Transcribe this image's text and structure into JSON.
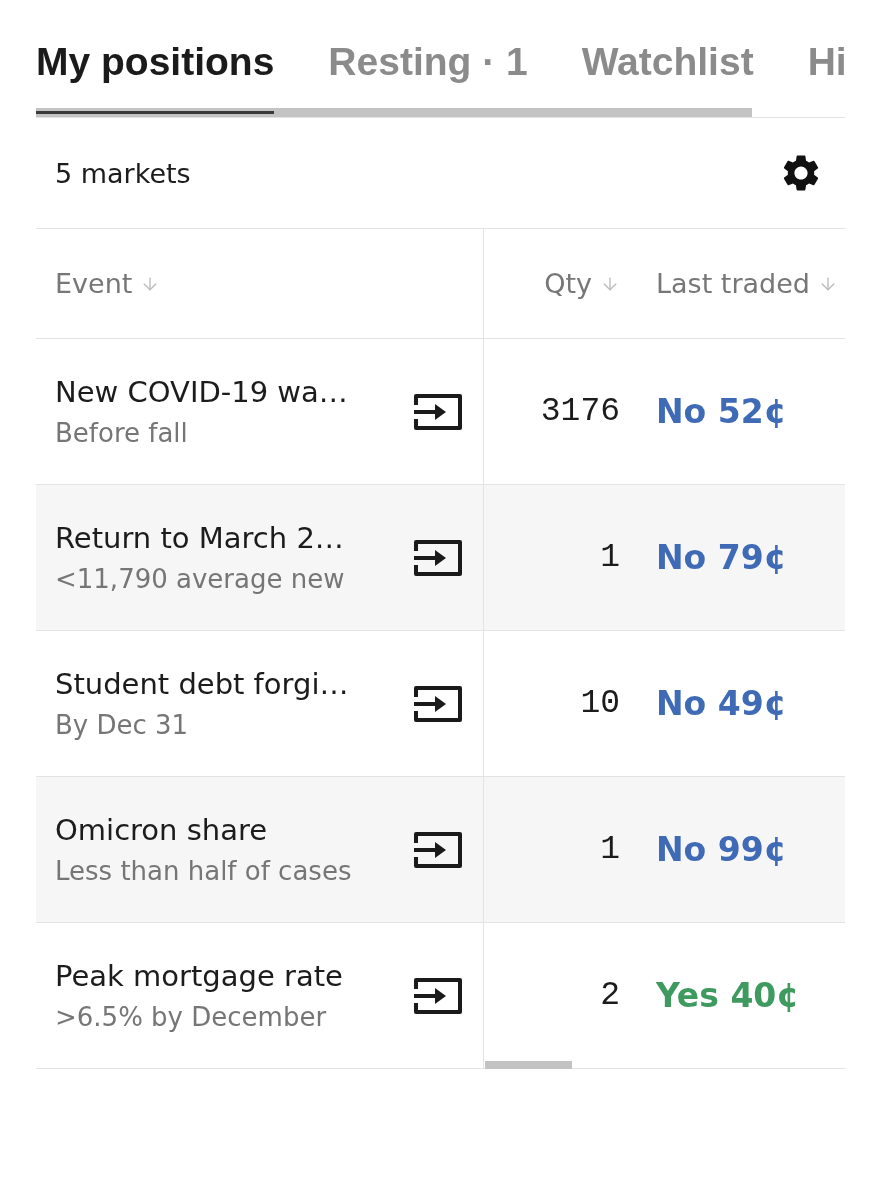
{
  "tabs": [
    {
      "label": "My positions",
      "selected": true
    },
    {
      "label": "Resting · 1",
      "selected": false
    },
    {
      "label": "Watchlist",
      "selected": false
    },
    {
      "label": "Hi",
      "selected": false
    }
  ],
  "summary": {
    "count_label": "5 markets"
  },
  "table": {
    "columns": [
      "Event",
      "Qty",
      "Last traded"
    ],
    "rows": [
      {
        "title": "New COVID-19 wa…",
        "subtitle": "Before fall",
        "qty": "3176",
        "last_traded": "No 52¢",
        "color": "#3f6ab6"
      },
      {
        "title": "Return to March 2…",
        "subtitle": "<11,790 average new",
        "qty": "1",
        "last_traded": "No 79¢",
        "color": "#3f6ab6"
      },
      {
        "title": "Student debt forgi…",
        "subtitle": "By Dec 31",
        "qty": "10",
        "last_traded": "No 49¢",
        "color": "#3f6ab6"
      },
      {
        "title": "Omicron share",
        "subtitle": "Less than half of cases",
        "qty": "1",
        "last_traded": "No 99¢",
        "color": "#3f6ab6"
      },
      {
        "title": "Peak mortgage rate",
        "subtitle": ">6.5% by December",
        "qty": "2",
        "last_traded": "Yes 40¢",
        "color": "#3f9a5f"
      }
    ]
  }
}
